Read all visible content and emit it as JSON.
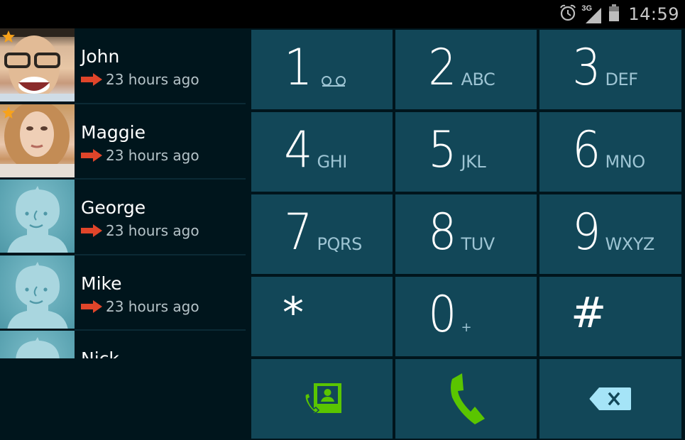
{
  "status_bar": {
    "icons": [
      "alarm-icon",
      "signal-3g-icon",
      "battery-icon"
    ],
    "network_label": "3G",
    "time": "14:59"
  },
  "recents": {
    "items": [
      {
        "name": "John",
        "time": "23 hours ago",
        "call_type": "outgoing",
        "favorite": true,
        "avatar": "photo"
      },
      {
        "name": "Maggie",
        "time": "23 hours ago",
        "call_type": "outgoing",
        "favorite": true,
        "avatar": "photo"
      },
      {
        "name": "George",
        "time": "23 hours ago",
        "call_type": "outgoing",
        "favorite": false,
        "avatar": "default"
      },
      {
        "name": "Mike",
        "time": "23 hours ago",
        "call_type": "outgoing",
        "favorite": false,
        "avatar": "default"
      },
      {
        "name": "Nick",
        "time": "",
        "call_type": "",
        "favorite": false,
        "avatar": "default"
      }
    ]
  },
  "dialpad": {
    "keys": [
      {
        "digit": "1",
        "sub": "",
        "sub_icon": "voicemail-icon"
      },
      {
        "digit": "2",
        "sub": "ABC"
      },
      {
        "digit": "3",
        "sub": "DEF"
      },
      {
        "digit": "4",
        "sub": "GHI"
      },
      {
        "digit": "5",
        "sub": "JKL"
      },
      {
        "digit": "6",
        "sub": "MNO"
      },
      {
        "digit": "7",
        "sub": "PQRS"
      },
      {
        "digit": "8",
        "sub": "TUV"
      },
      {
        "digit": "9",
        "sub": "WXYZ"
      },
      {
        "digit": "*",
        "sub": ""
      },
      {
        "digit": "0",
        "sub": "+"
      },
      {
        "digit": "#",
        "sub": ""
      }
    ],
    "actions": [
      {
        "name": "contacts-button",
        "icon": "contacts-call-icon"
      },
      {
        "name": "call-button",
        "icon": "phone-icon"
      },
      {
        "name": "backspace-button",
        "icon": "backspace-icon"
      }
    ]
  },
  "colors": {
    "key_bg": "#124758",
    "panel_bg": "#00151c",
    "accent_green": "#5ac500",
    "arrow_red": "#e0452a",
    "backspace_blue": "#a5e4f7",
    "subtext": "#9dc4d3",
    "star": "#f7a21b"
  }
}
